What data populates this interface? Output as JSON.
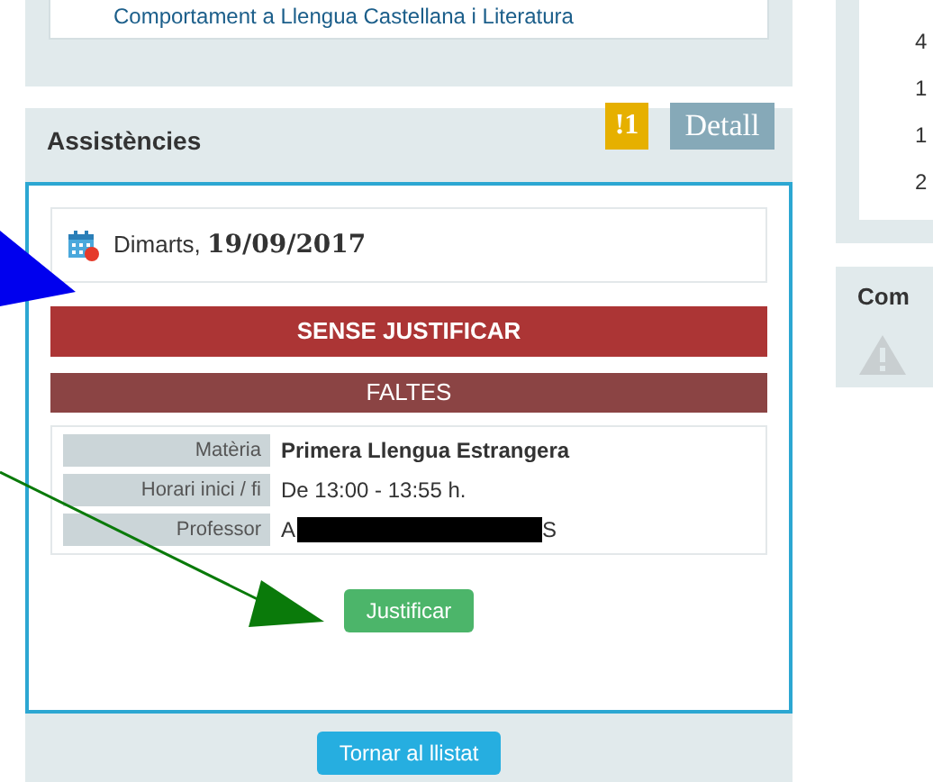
{
  "top_panel": {
    "subject": "Comportament a Llengua Castellana i Literatura"
  },
  "assistencies": {
    "title": "Assistències",
    "alert_badge": "!1",
    "detail_button": "Detall",
    "date": {
      "weekday": "Dimarts,",
      "date": "19/09/2017"
    },
    "status": "SENSE JUSTIFICAR",
    "type": "FALTES",
    "details": [
      {
        "label": "Matèria",
        "value": "Primera Llengua Estrangera",
        "bold": true,
        "redacted": false
      },
      {
        "label": "Horari inici / fi",
        "value": "De 13:00 - 13:55 h.",
        "bold": false,
        "redacted": false
      },
      {
        "label": "Professor",
        "value": "A",
        "value_end": "S",
        "bold": false,
        "redacted": true
      }
    ],
    "justify_button": "Justificar",
    "back_button": "Tornar al llistat"
  },
  "right_panel": {
    "numbers": [
      "4",
      "1",
      "1",
      "2"
    ],
    "second_title": "Com"
  }
}
